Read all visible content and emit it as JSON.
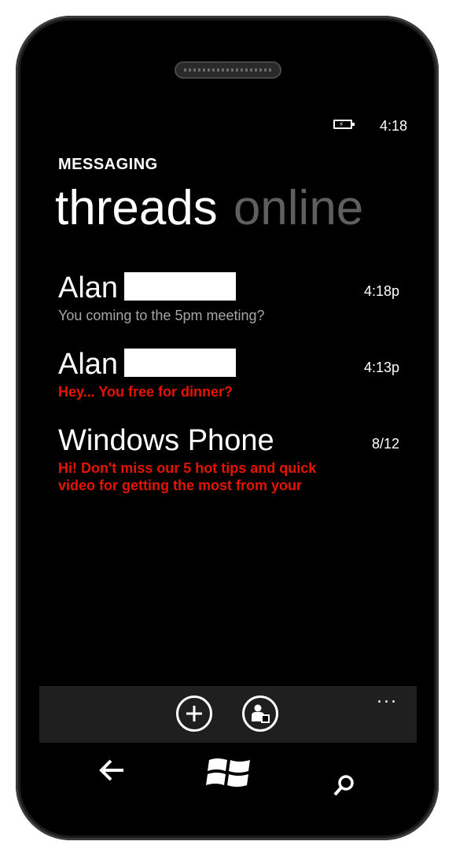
{
  "status_bar": {
    "time": "4:18"
  },
  "header": {
    "app_title": "MESSAGING",
    "pivots": [
      {
        "label": "threads",
        "active": true
      },
      {
        "label": "online",
        "active": false
      }
    ]
  },
  "threads": [
    {
      "name": "Alan",
      "time": "4:18p",
      "preview": "You coming to the 5pm meeting?",
      "unread": false
    },
    {
      "name": "Alan",
      "time": "4:13p",
      "preview": "Hey... You free for dinner?",
      "unread": true
    },
    {
      "name": "Windows Phone",
      "time": "8/12",
      "preview_lines": [
        "Hi! Don't miss our 5 hot tips and quick",
        "video for getting the most from your"
      ],
      "unread": true
    }
  ],
  "app_bar": {
    "more": "...",
    "buttons": [
      {
        "icon": "plus-icon",
        "label": "new"
      },
      {
        "icon": "person-status-icon",
        "label": "set status"
      }
    ]
  },
  "hardware_buttons": [
    "back-icon",
    "windows-start-icon",
    "search-icon"
  ],
  "colors": {
    "accent": "#e51400",
    "inactive_pivot": "#5f5f5f",
    "read_preview": "#a6a6a6"
  }
}
